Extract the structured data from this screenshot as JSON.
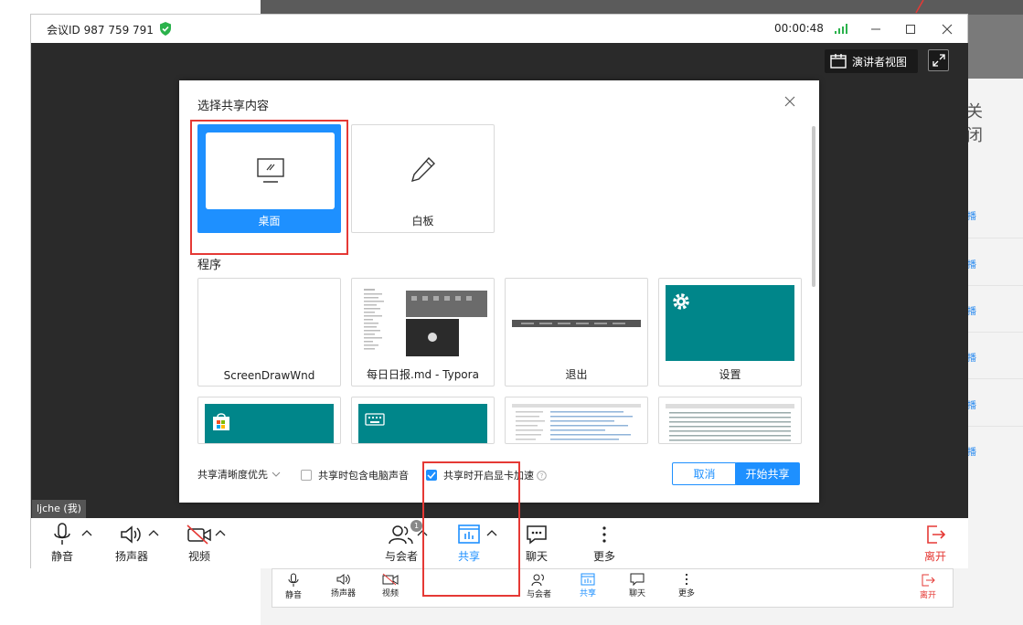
{
  "background_app": {
    "close_text": "关闭",
    "side_links": [
      "播",
      "播",
      "播",
      "播",
      "播",
      "播"
    ]
  },
  "window": {
    "meeting_id": "会议ID 987 759 791",
    "timer": "00:00:48",
    "presenter_view_label": "演讲者视图",
    "self_label": "ljche (我)"
  },
  "toolbar": {
    "mute": "静音",
    "speaker": "扬声器",
    "video": "视频",
    "participants": "与会者",
    "participants_count": "1",
    "share": "共享",
    "chat": "聊天",
    "more": "更多",
    "leave": "离开"
  },
  "dialog": {
    "title": "选择共享内容",
    "desktop_label": "桌面",
    "whiteboard_label": "白板",
    "programs_title": "程序",
    "programs": [
      "ScreenDrawWnd",
      "每日日报.md - Typora",
      "退出",
      "设置"
    ],
    "clarity_label": "共享清晰度优先",
    "include_audio_label": "共享时包含电脑声音",
    "include_audio_checked": false,
    "gpu_accel_label": "共享时开启显卡加速",
    "gpu_accel_checked": true,
    "cancel_label": "取消",
    "start_label": "开始共享"
  },
  "colors": {
    "accent": "#1e90ff",
    "leave": "#e53935",
    "teal": "#00868a",
    "stage": "#2a2a2a"
  }
}
